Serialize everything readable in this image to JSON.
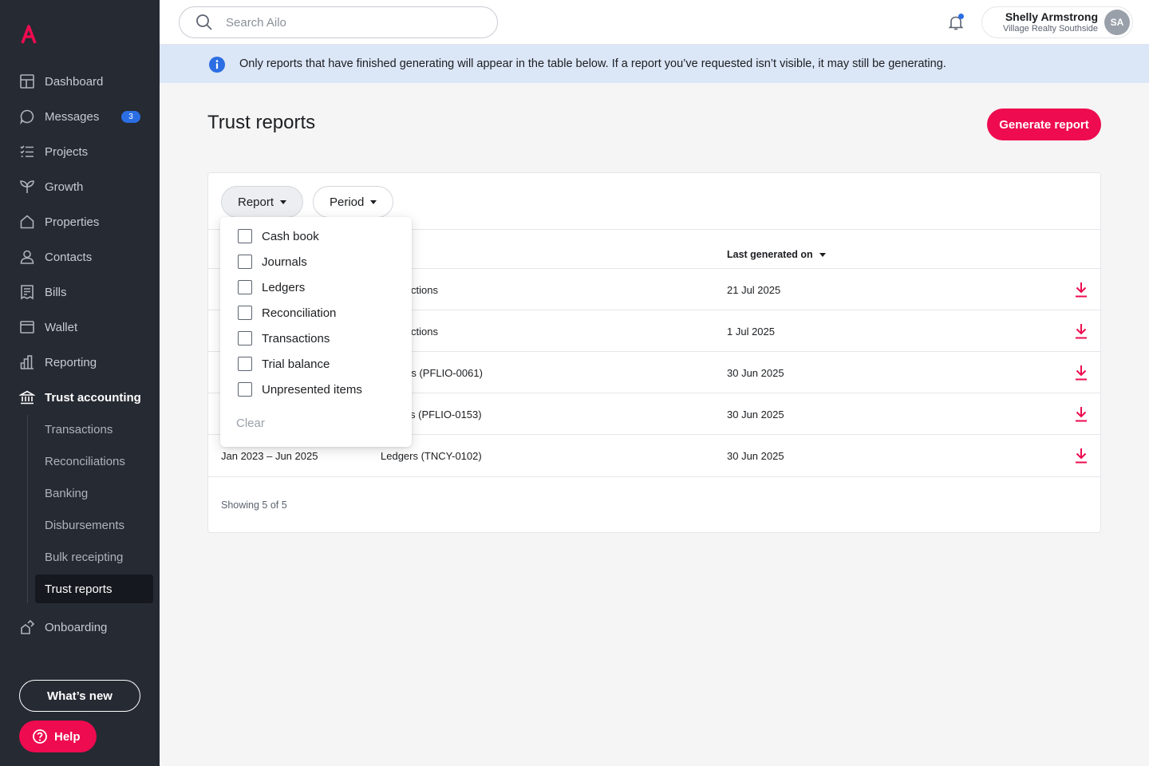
{
  "brand": {
    "accent": "#ee0b4f",
    "sidebar_bg": "#262a33",
    "info_blue": "#2b6ee4"
  },
  "sidebar": {
    "items": [
      {
        "label": "Dashboard",
        "icon": "dashboard-icon"
      },
      {
        "label": "Messages",
        "icon": "message-bubble-icon",
        "badge": "3"
      },
      {
        "label": "Projects",
        "icon": "checklist-icon"
      },
      {
        "label": "Growth",
        "icon": "sprout-icon"
      },
      {
        "label": "Properties",
        "icon": "house-icon"
      },
      {
        "label": "Contacts",
        "icon": "person-icon"
      },
      {
        "label": "Bills",
        "icon": "receipt-icon"
      },
      {
        "label": "Wallet",
        "icon": "wallet-icon"
      },
      {
        "label": "Reporting",
        "icon": "bar-chart-icon"
      },
      {
        "label": "Trust accounting",
        "icon": "bank-icon",
        "active": true
      }
    ],
    "subitems": [
      {
        "label": "Transactions"
      },
      {
        "label": "Reconciliations"
      },
      {
        "label": "Banking"
      },
      {
        "label": "Disbursements"
      },
      {
        "label": "Bulk receipting"
      },
      {
        "label": "Trust reports",
        "active": true
      }
    ],
    "onboarding": {
      "label": "Onboarding",
      "icon": "onboarding-icon"
    },
    "whats_new": "What’s new",
    "help": "Help"
  },
  "topbar": {
    "search_placeholder": "Search Ailo",
    "user_name": "Shelly Armstrong",
    "user_org": "Village Realty Southside",
    "avatar_initials": "SA"
  },
  "banner": {
    "text": "Only reports that have finished generating will appear in the table below. If a report you’ve requested isn’t visible, it may still be generating."
  },
  "page": {
    "title": "Trust reports",
    "generate_button": "Generate report"
  },
  "filters": {
    "report_label": "Report",
    "period_label": "Period"
  },
  "table": {
    "sort_header": "Last generated on",
    "rows": [
      {
        "period": "",
        "report": "ctions",
        "generated": "21 Jul 2025"
      },
      {
        "period": "",
        "report": "ctions",
        "generated": "1 Jul 2025"
      },
      {
        "period": "",
        "report": "rs (PFLIO-0061)",
        "generated": "30 Jun 2025"
      },
      {
        "period": "",
        "report": "s (PFLIO-0153)",
        "generated": "30 Jun 2025"
      },
      {
        "period": "Jan 2023 – Jun 2025",
        "report": "Ledgers (TNCY-0102)",
        "generated": "30 Jun 2025"
      }
    ],
    "showing": "Showing 5 of 5"
  },
  "report_dropdown": {
    "options": [
      {
        "label": "Cash book",
        "checked": false
      },
      {
        "label": "Journals",
        "checked": false
      },
      {
        "label": "Ledgers",
        "checked": false
      },
      {
        "label": "Reconciliation",
        "checked": false
      },
      {
        "label": "Transactions",
        "checked": false
      },
      {
        "label": "Trial balance",
        "checked": false
      },
      {
        "label": "Unpresented items",
        "checked": false
      }
    ],
    "clear_label": "Clear"
  }
}
